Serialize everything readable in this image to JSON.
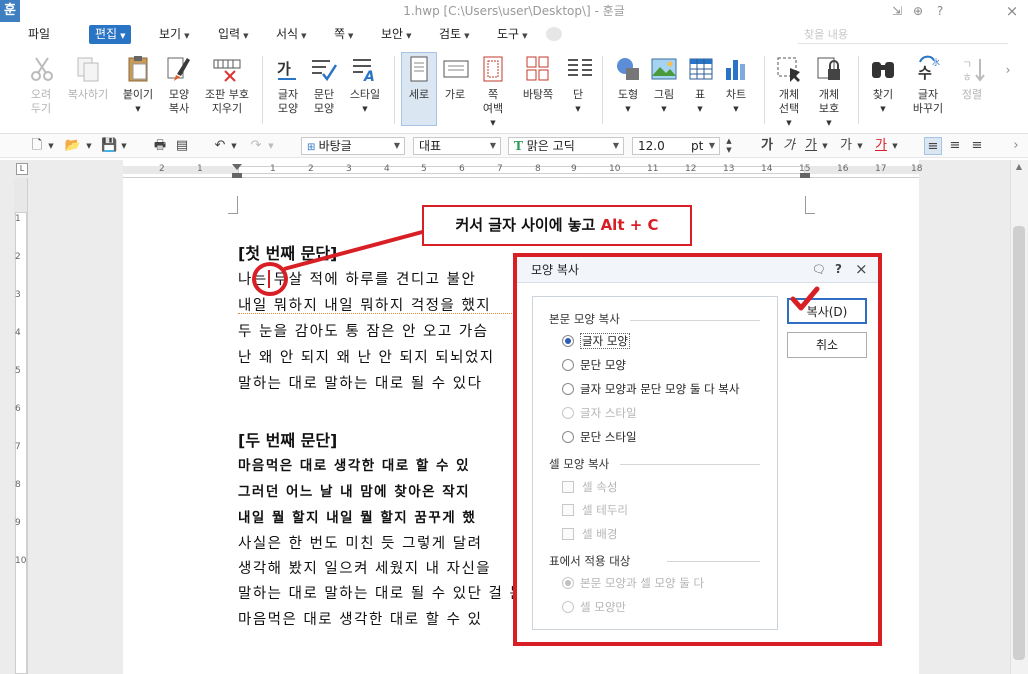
{
  "window": {
    "app_icon": "훈",
    "title": "1.hwp [C:\\Users\\user\\Desktop\\] - 훈글",
    "controls": [
      "⇲",
      "⊕",
      "?",
      "×"
    ]
  },
  "menu": {
    "items": [
      {
        "label": "파일"
      },
      {
        "label": "편집"
      },
      {
        "label": "보기"
      },
      {
        "label": "입력"
      },
      {
        "label": "서식"
      },
      {
        "label": "쪽"
      },
      {
        "label": "보안"
      },
      {
        "label": "검토"
      },
      {
        "label": "도구"
      }
    ],
    "search_placeholder": "찾을 내용"
  },
  "ribbon": {
    "cut": "오려\n두기",
    "copy": "복사하기",
    "paste": "붙이기",
    "format_copy": "모양\n복사",
    "remove_codes": "조판 부호\n지우기",
    "char_shape": "글자\n모양",
    "para_shape": "문단\n모양",
    "style": "스타일",
    "portrait": "세로",
    "landscape": "가로",
    "margin": "쪽\n여백",
    "background": "바탕쪽",
    "columns": "단",
    "shapes": "도형",
    "picture": "그림",
    "table": "표",
    "chart": "차트",
    "select_object": "개체\n선택",
    "protect_object": "개체\n보호",
    "find": "찾기",
    "replace": "글자\n바꾸기",
    "sort": "정렬"
  },
  "toolbar2": {
    "style": "바탕글",
    "lang": "대표",
    "font": "맑은 고딕",
    "size": "12.0",
    "unit": "pt",
    "font_badge": "T"
  },
  "ruler": {
    "h": [
      "2",
      "1",
      "1",
      "2",
      "3",
      "4",
      "5",
      "6",
      "7",
      "8",
      "9",
      "10",
      "11",
      "12",
      "13",
      "14",
      "15",
      "16",
      "17",
      "18"
    ],
    "v": [
      "1",
      "2",
      "3",
      "4",
      "5",
      "6",
      "7",
      "8",
      "9",
      "10"
    ]
  },
  "callout": {
    "text": "커서 글자 사이에 놓고",
    "keys": "Alt + C"
  },
  "document": {
    "heading1": "[첫 번째 문단]",
    "p1": [
      "나는 무살 적에 하루를 견디고 불안",
      "내일 뭐하지 내일 뭐하지 걱정을 했지",
      "두 눈을 감아도 통 잠은 안 오고 가슴",
      "난 왜 안 되지 왜 난 안 되지 되뇌었지",
      "말하는 대로 말하는 대로 될 수 있다"
    ],
    "heading2": "[두 번째 문단]",
    "p2": [
      "마음먹은 대로 생각한 대로 할 수 있",
      "그러던 어느 날 내 맘에 찾아온 작지",
      "내일 뭘 할지 내일 뭘 할지 꿈꾸게 했",
      "사실은 한 번도 미친 듯 그렇게 달려",
      "생각해 봤지 일으켜 세웠지 내 자신을",
      "말하는 대로 말하는 대로 될 수 있단 걸 눈",
      "마음먹은 대로 생각한 대로 할 수 있"
    ]
  },
  "dialog": {
    "title": "모양 복사",
    "group1": "본문 모양 복사",
    "opt_char": "글자 모양",
    "opt_para": "문단 모양",
    "opt_both": "글자 모양과 문단 모양 둘 다 복사",
    "opt_char_style": "글자 스타일",
    "opt_para_style": "문단 스타일",
    "group2": "셀 모양 복사",
    "cell_attr": "셀 속성",
    "cell_border": "셀 테두리",
    "cell_bg": "셀 배경",
    "group3": "표에서 적용 대상",
    "apply_both": "본문 모양과 셀 모양 둘 다",
    "apply_cell": "셀 모양만",
    "copy_btn": "복사(D)",
    "cancel_btn": "취소"
  },
  "colors": {
    "accent": "#2a74c5",
    "highlight_red": "#d91f26"
  }
}
